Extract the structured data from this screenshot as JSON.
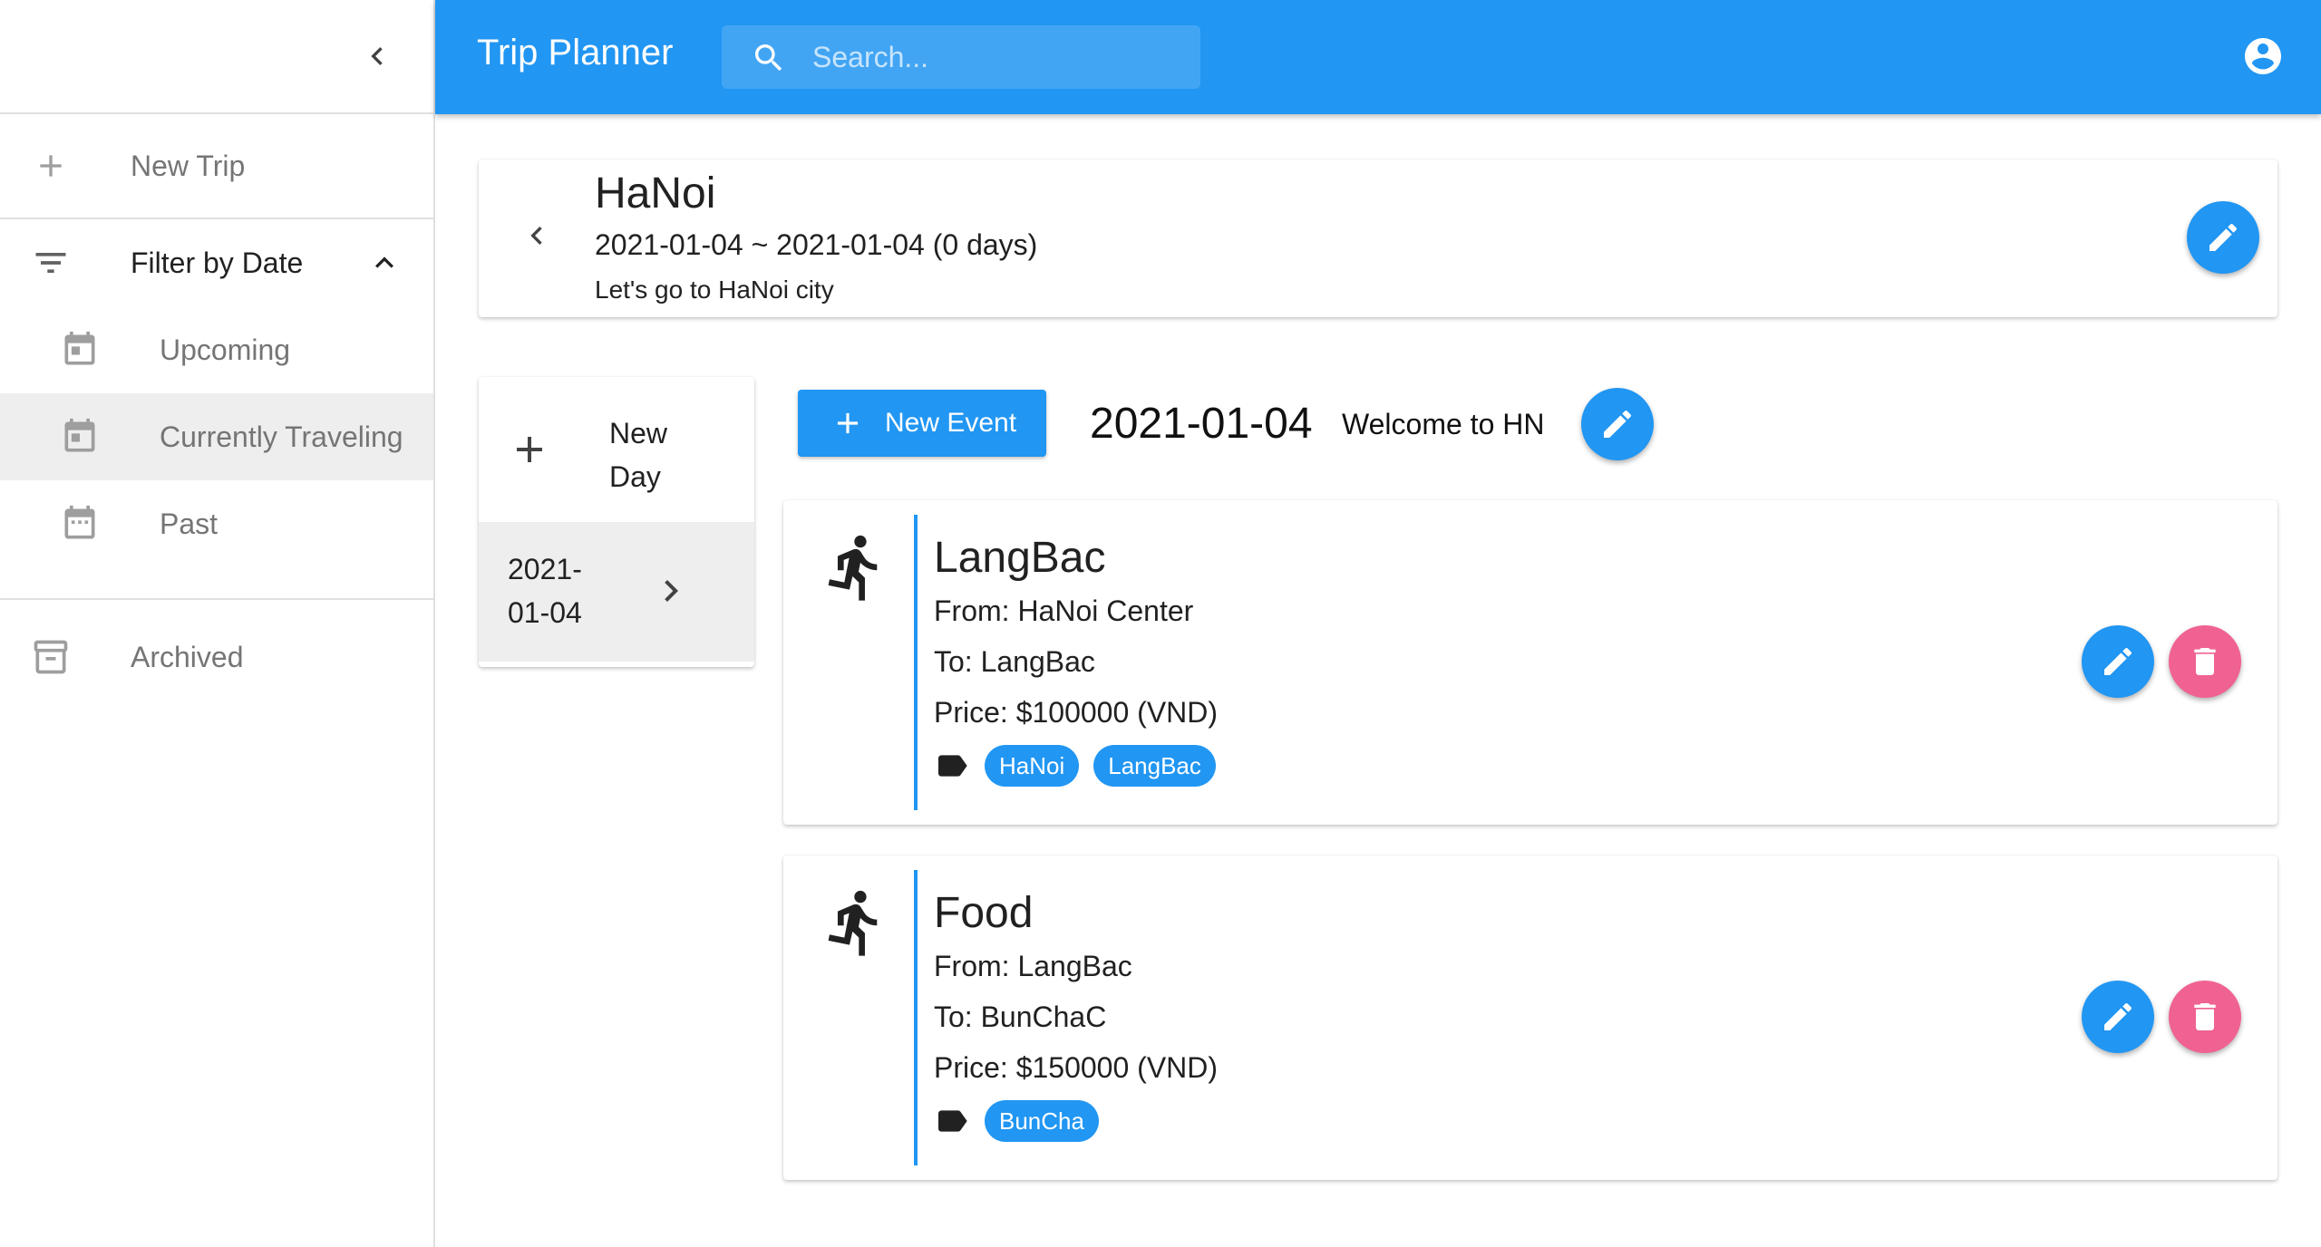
{
  "app": {
    "title": "Trip Planner"
  },
  "search": {
    "placeholder": "Search..."
  },
  "sidebar": {
    "new_trip": "New Trip",
    "filter": "Filter by Date",
    "filters": [
      "Upcoming",
      "Currently Traveling",
      "Past"
    ],
    "archived": "Archived"
  },
  "trip": {
    "title": "HaNoi",
    "dates": "2021-01-04 ~ 2021-01-04 (0 days)",
    "description": "Let's go to HaNoi city"
  },
  "days": {
    "new_day": "New Day",
    "items": [
      "2021-01-04"
    ]
  },
  "day": {
    "new_event": "New Event",
    "date": "2021-01-04",
    "name": "Welcome to HN"
  },
  "events": [
    {
      "name": "LangBac",
      "from": "From: HaNoi Center",
      "to": "To: LangBac",
      "price": "Price: $100000 (VND)",
      "tags": [
        "HaNoi",
        "LangBac"
      ]
    },
    {
      "name": "Food",
      "from": "From: LangBac",
      "to": "To: BunChaC",
      "price": "Price: $150000 (VND)",
      "tags": [
        "BunCha"
      ]
    }
  ],
  "colors": {
    "primary": "#2196f3",
    "delete": "#f06292"
  }
}
